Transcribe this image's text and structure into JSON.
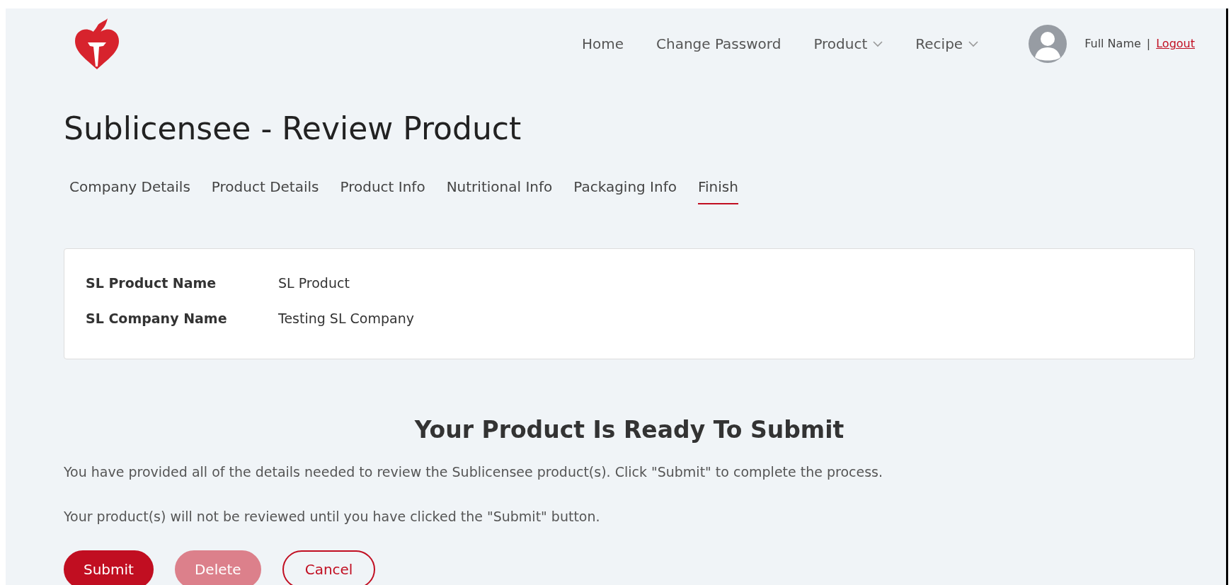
{
  "nav": {
    "items": [
      {
        "label": "Home",
        "dropdown": false
      },
      {
        "label": "Change Password",
        "dropdown": false
      },
      {
        "label": "Product",
        "dropdown": true
      },
      {
        "label": "Recipe",
        "dropdown": true
      }
    ],
    "user_name": "Full Name",
    "separator": "|",
    "logout": "Logout"
  },
  "title": "Sublicensee - Review Product",
  "tabs": [
    {
      "label": "Company Details",
      "selected": false
    },
    {
      "label": "Product Details",
      "selected": false
    },
    {
      "label": "Product Info",
      "selected": false
    },
    {
      "label": "Nutritional Info",
      "selected": false
    },
    {
      "label": "Packaging Info",
      "selected": false
    },
    {
      "label": "Finish",
      "selected": true
    }
  ],
  "summary": [
    {
      "label": "SL Product Name",
      "value": "SL Product"
    },
    {
      "label": "SL Company Name",
      "value": "Testing SL Company"
    }
  ],
  "heading": "Your Product Is Ready To Submit",
  "paragraphs": [
    "You have provided all of the details needed to review the Sublicensee product(s). Click \"Submit\" to complete the process.",
    "Your product(s) will not be reviewed until you have clicked the \"Submit\" button."
  ],
  "buttons": [
    {
      "label": "Submit",
      "kind": "primary",
      "disabled": false
    },
    {
      "label": "Delete",
      "kind": "primary",
      "disabled": true
    },
    {
      "label": "Cancel",
      "kind": "outline",
      "disabled": false
    }
  ]
}
